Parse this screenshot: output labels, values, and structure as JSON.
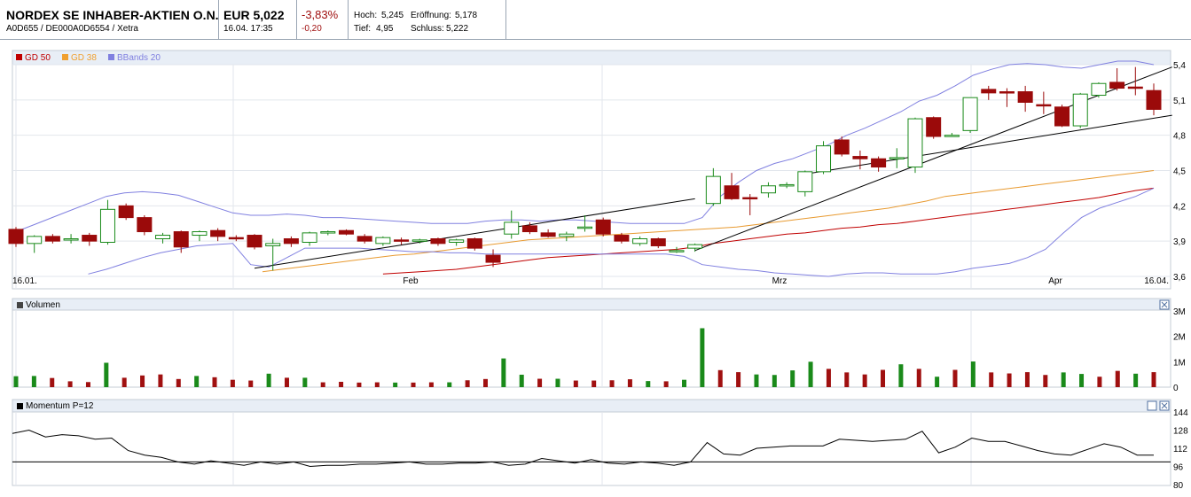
{
  "header": {
    "name": "NORDEX SE INHABER-AKTIEN O.N.",
    "isin": "A0D655 / DE000A0D6554 / Xetra",
    "price": "EUR 5,022",
    "time": "16.04. 17:35",
    "change_pct": "-3,83%",
    "change_abs": "-0,20",
    "hoch_label": "Hoch:",
    "hoch": "5,245",
    "eroeffnung_label": "Eröffnung:",
    "eroeffnung": "5,178",
    "tief_label": "Tief:",
    "tief": "4,95",
    "schluss_label": "Schluss:",
    "schluss": "5,222"
  },
  "legend": [
    {
      "label": "GD 50",
      "color": "#c00000"
    },
    {
      "label": "GD 38",
      "color": "#f0a030"
    },
    {
      "label": "BBands 20",
      "color": "#8080e0"
    }
  ],
  "panels": {
    "volume_title": "Volumen",
    "momentum_title": "Momentum P=12"
  },
  "chart_data": [
    {
      "type": "candlestick",
      "title": "",
      "x_tick_labels": [
        "16.01.",
        "Feb",
        "Mrz",
        "Apr",
        "16.04."
      ],
      "y_ticks": [
        "5,4",
        "5,1",
        "4,8",
        "4,5",
        "4,2",
        "3,9",
        "3,6"
      ],
      "ylim": [
        3.6,
        5.4
      ],
      "grid": true,
      "up_color": "#1a8a1a",
      "down_color": "#9b0a0a",
      "candles": [
        [
          4.0,
          4.02,
          3.85,
          3.88
        ],
        [
          3.88,
          3.95,
          3.8,
          3.94
        ],
        [
          3.94,
          3.96,
          3.88,
          3.9
        ],
        [
          3.92,
          3.96,
          3.88,
          3.92
        ],
        [
          3.95,
          3.97,
          3.86,
          3.9
        ],
        [
          3.89,
          4.25,
          3.87,
          4.17
        ],
        [
          4.2,
          4.22,
          4.08,
          4.1
        ],
        [
          4.1,
          4.12,
          3.95,
          3.98
        ],
        [
          3.92,
          3.97,
          3.88,
          3.95
        ],
        [
          3.98,
          3.99,
          3.8,
          3.85
        ],
        [
          3.95,
          3.99,
          3.9,
          3.98
        ],
        [
          3.99,
          4.01,
          3.9,
          3.94
        ],
        [
          3.93,
          3.95,
          3.9,
          3.92
        ],
        [
          3.95,
          3.96,
          3.83,
          3.85
        ],
        [
          3.86,
          3.92,
          3.65,
          3.88
        ],
        [
          3.92,
          3.94,
          3.85,
          3.88
        ],
        [
          3.89,
          3.98,
          3.86,
          3.97
        ],
        [
          3.97,
          3.99,
          3.95,
          3.98
        ],
        [
          3.99,
          4.0,
          3.95,
          3.96
        ],
        [
          3.94,
          3.96,
          3.88,
          3.9
        ],
        [
          3.88,
          3.94,
          3.86,
          3.93
        ],
        [
          3.91,
          3.93,
          3.87,
          3.9
        ],
        [
          3.9,
          3.92,
          3.88,
          3.91
        ],
        [
          3.92,
          3.93,
          3.86,
          3.88
        ],
        [
          3.89,
          3.92,
          3.86,
          3.91
        ],
        [
          3.92,
          3.93,
          3.82,
          3.84
        ],
        [
          3.78,
          3.83,
          3.68,
          3.72
        ],
        [
          3.96,
          4.16,
          3.92,
          4.06
        ],
        [
          4.03,
          4.06,
          3.96,
          3.98
        ],
        [
          3.97,
          4.0,
          3.93,
          3.94
        ],
        [
          3.94,
          3.98,
          3.9,
          3.96
        ],
        [
          4.01,
          4.12,
          3.98,
          4.02
        ],
        [
          4.08,
          4.1,
          3.94,
          3.96
        ],
        [
          3.95,
          3.97,
          3.88,
          3.9
        ],
        [
          3.88,
          3.94,
          3.86,
          3.92
        ],
        [
          3.92,
          3.93,
          3.84,
          3.86
        ],
        [
          3.82,
          3.85,
          3.8,
          3.82
        ],
        [
          3.84,
          3.88,
          3.81,
          3.87
        ],
        [
          4.22,
          4.52,
          4.2,
          4.45
        ],
        [
          4.37,
          4.48,
          4.25,
          4.26
        ],
        [
          4.27,
          4.3,
          4.12,
          4.26
        ],
        [
          4.31,
          4.4,
          4.27,
          4.37
        ],
        [
          4.37,
          4.4,
          4.35,
          4.38
        ],
        [
          4.32,
          4.5,
          4.28,
          4.49
        ],
        [
          4.49,
          4.75,
          4.47,
          4.71
        ],
        [
          4.76,
          4.79,
          4.62,
          4.64
        ],
        [
          4.62,
          4.67,
          4.51,
          4.6
        ],
        [
          4.6,
          4.62,
          4.49,
          4.53
        ],
        [
          4.6,
          4.69,
          4.52,
          4.61
        ],
        [
          4.53,
          4.95,
          4.48,
          4.94
        ],
        [
          4.95,
          4.96,
          4.77,
          4.79
        ],
        [
          4.8,
          4.82,
          4.79,
          4.8
        ],
        [
          4.84,
          5.1,
          4.82,
          5.12
        ],
        [
          5.19,
          5.22,
          5.1,
          5.16
        ],
        [
          5.17,
          5.2,
          5.04,
          5.16
        ],
        [
          5.17,
          5.22,
          5.0,
          5.08
        ],
        [
          5.06,
          5.17,
          4.98,
          5.05
        ],
        [
          5.04,
          5.06,
          4.87,
          4.88
        ],
        [
          4.88,
          5.16,
          4.86,
          5.15
        ],
        [
          5.14,
          5.25,
          5.12,
          5.24
        ],
        [
          5.25,
          5.37,
          5.18,
          5.2
        ],
        [
          5.21,
          5.38,
          5.14,
          5.2
        ],
        [
          5.18,
          5.24,
          4.97,
          5.02
        ]
      ],
      "lines": {
        "GD 50": [
          null,
          null,
          null,
          null,
          null,
          null,
          null,
          null,
          null,
          null,
          null,
          null,
          null,
          null,
          null,
          null,
          null,
          null,
          null,
          null,
          3.62,
          3.63,
          3.64,
          3.65,
          3.66,
          3.68,
          3.7,
          3.72,
          3.74,
          3.76,
          3.77,
          3.78,
          3.79,
          3.8,
          3.81,
          3.82,
          3.83,
          3.85,
          3.88,
          3.9,
          3.92,
          3.94,
          3.96,
          3.97,
          3.99,
          4.01,
          4.02,
          4.04,
          4.05,
          4.07,
          4.09,
          4.11,
          4.13,
          4.15,
          4.17,
          4.19,
          4.21,
          4.23,
          4.25,
          4.27,
          4.3,
          4.33,
          4.35
        ],
        "GD 38": [
          null,
          null,
          null,
          null,
          null,
          null,
          null,
          null,
          null,
          null,
          null,
          null,
          null,
          3.64,
          3.66,
          3.68,
          3.7,
          3.72,
          3.74,
          3.76,
          3.78,
          3.79,
          3.81,
          3.83,
          3.85,
          3.87,
          3.89,
          3.91,
          3.92,
          3.93,
          3.94,
          3.95,
          3.96,
          3.97,
          3.98,
          3.99,
          4.0,
          4.01,
          4.02,
          4.04,
          4.06,
          4.08,
          4.1,
          4.12,
          4.14,
          4.16,
          4.18,
          4.21,
          4.24,
          4.28,
          4.3,
          4.32,
          4.34,
          4.36,
          4.38,
          4.4,
          4.42,
          4.44,
          4.46,
          4.48,
          4.5
        ],
        "BBands 20 upper": [
          3.98,
          4.04,
          4.1,
          4.16,
          4.22,
          4.28,
          4.31,
          4.32,
          4.31,
          4.29,
          4.24,
          4.19,
          4.14,
          4.12,
          4.12,
          4.13,
          4.12,
          4.1,
          4.1,
          4.09,
          4.08,
          4.07,
          4.06,
          4.05,
          4.05,
          4.05,
          4.07,
          4.08,
          4.08,
          4.07,
          4.08,
          4.08,
          4.07,
          4.06,
          4.05,
          4.05,
          4.05,
          4.05,
          4.1,
          4.28,
          4.4,
          4.5,
          4.56,
          4.6,
          4.66,
          4.72,
          4.8,
          4.86,
          4.93,
          5.0,
          5.09,
          5.14,
          5.22,
          5.31,
          5.36,
          5.4,
          5.41,
          5.4,
          5.38,
          5.37,
          5.4,
          5.43,
          5.43,
          5.4
        ],
        "BBands 20 lower": [
          null,
          null,
          null,
          null,
          3.62,
          3.66,
          3.71,
          3.76,
          3.8,
          3.83,
          3.86,
          3.87,
          3.88,
          3.7,
          3.68,
          3.76,
          3.84,
          3.84,
          3.84,
          3.84,
          3.83,
          3.82,
          3.81,
          3.81,
          3.8,
          3.8,
          3.79,
          3.79,
          3.79,
          3.79,
          3.79,
          3.79,
          3.79,
          3.79,
          3.79,
          3.79,
          3.79,
          3.77,
          3.7,
          3.68,
          3.66,
          3.65,
          3.63,
          3.62,
          3.61,
          3.6,
          3.62,
          3.63,
          3.63,
          3.62,
          3.62,
          3.62,
          3.64,
          3.67,
          3.69,
          3.71,
          3.76,
          3.83,
          3.97,
          4.1,
          4.18,
          4.23,
          4.28,
          4.35
        ]
      },
      "trendlines": [
        {
          "from": [
            13,
            3.67
          ],
          "to": [
            37,
            4.26
          ]
        },
        {
          "from": [
            37,
            3.82
          ],
          "to": [
            63,
            5.38
          ]
        },
        {
          "from": [
            43,
            4.47
          ],
          "to": [
            63,
            4.97
          ]
        }
      ]
    },
    {
      "type": "bar",
      "title": "Volumen",
      "y_ticks": [
        "3M",
        "2M",
        "1M",
        "0"
      ],
      "ylim": [
        0,
        3000000
      ],
      "values": [
        430000,
        440000,
        360000,
        230000,
        200000,
        960000,
        370000,
        460000,
        500000,
        320000,
        440000,
        390000,
        290000,
        260000,
        530000,
        370000,
        370000,
        190000,
        210000,
        180000,
        190000,
        180000,
        180000,
        190000,
        190000,
        270000,
        320000,
        1130000,
        490000,
        330000,
        330000,
        260000,
        260000,
        270000,
        310000,
        240000,
        230000,
        290000,
        2320000,
        670000,
        590000,
        500000,
        480000,
        660000,
        1000000,
        720000,
        580000,
        500000,
        680000,
        900000,
        720000,
        410000,
        680000,
        1010000,
        580000,
        540000,
        590000,
        480000,
        580000,
        520000,
        410000,
        640000,
        530000,
        590000
      ],
      "colors": [
        "g",
        "g",
        "r",
        "r",
        "r",
        "g",
        "r",
        "r",
        "r",
        "r",
        "g",
        "r",
        "r",
        "r",
        "g",
        "r",
        "g",
        "r",
        "r",
        "r",
        "r",
        "g",
        "r",
        "r",
        "g",
        "r",
        "r",
        "g",
        "g",
        "r",
        "g",
        "r",
        "r",
        "r",
        "r",
        "g",
        "r",
        "g",
        "g",
        "r",
        "r",
        "g",
        "g",
        "g",
        "g",
        "r",
        "r",
        "r",
        "r",
        "g",
        "r",
        "g",
        "r",
        "g",
        "r",
        "r",
        "r",
        "r",
        "g",
        "g",
        "r",
        "r",
        "g",
        "r"
      ]
    },
    {
      "type": "line",
      "title": "Momentum P=12",
      "y_ticks": [
        "144",
        "128",
        "112",
        "96",
        "80"
      ],
      "ylim": [
        80,
        144
      ],
      "reference": 100,
      "values": [
        125,
        128,
        122,
        124,
        123,
        120,
        121,
        110,
        106,
        104,
        100,
        98,
        101,
        99,
        97,
        100,
        98,
        100,
        96,
        97,
        97,
        98,
        98,
        99,
        100,
        98,
        98,
        99,
        99,
        100,
        97,
        98,
        103,
        101,
        99,
        102,
        99,
        98,
        100,
        99,
        97,
        100,
        117,
        107,
        106,
        112,
        113,
        114,
        114,
        114,
        120,
        119,
        118,
        119,
        120,
        127,
        108,
        113,
        121,
        118,
        118,
        114,
        110,
        107,
        106,
        111,
        116,
        113,
        106,
        106
      ]
    }
  ]
}
